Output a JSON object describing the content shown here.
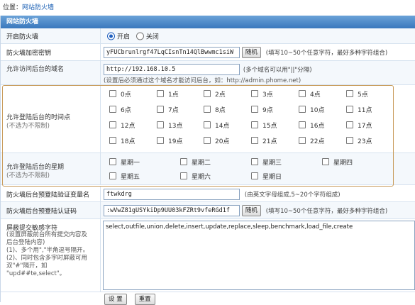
{
  "breadcrumb": {
    "prefix": "位置：",
    "link": "网站防火墙"
  },
  "section_title": "网站防火墙",
  "firewall": {
    "label": "开启防火墙",
    "on": "开启",
    "off": "关闭"
  },
  "key": {
    "label": "防火墙加密密钥",
    "value": "yFUCbrunlrgf47LqCIsnTn14QlBwwmc1siW",
    "button": "随机",
    "hint": "(填写10~50个任意字符，最好多种字符组合)"
  },
  "domain": {
    "label": "允许访问后台的域名",
    "value": "http://192.168.10.5",
    "hint1": "(多个域名可以用\"||\"分隔)",
    "hint2": "(设置后必须通过这个域名才能访问后台，如：http://admin.phome.net)"
  },
  "time": {
    "label": "允许登陆后台的时间点",
    "sublabel": "(不选为不限制)",
    "hours": [
      "0点",
      "1点",
      "2点",
      "3点",
      "4点",
      "5点",
      "6点",
      "7点",
      "8点",
      "9点",
      "10点",
      "11点",
      "12点",
      "13点",
      "14点",
      "15点",
      "16点",
      "17点",
      "18点",
      "19点",
      "20点",
      "21点",
      "22点",
      "23点"
    ]
  },
  "week": {
    "label": "允许登陆后台的星期",
    "sublabel": "(不选为不限制)",
    "days": [
      "星期一",
      "星期二",
      "星期三",
      "星期四",
      "星期五",
      "星期六",
      "星期日"
    ]
  },
  "verify_var": {
    "label": "防火墙后台预登陆验证变量名",
    "value": "ftwkdrg",
    "hint": "(由英文字母组成,5~20个字符组成)"
  },
  "auth_code": {
    "label": "防火墙后台预登陆认证码",
    "value": ":wVwZ81gUSYkiDp9UU03kFZRt9vfeRGd1f",
    "button": "随机",
    "hint": "(填写10~50个任意字符，最好多种字符组合)"
  },
  "sensitive": {
    "label": "屏蔽提交敏感字符",
    "desc": [
      "(设置屏蔽前台所有提交内容及",
      "后台登陆内容)",
      "(1)、多个用\",\"半角逗号隔开。",
      "(2)、同时包含多字时屏蔽可用",
      "双\"#\"隔开，如",
      "\"upd##te,select\"。"
    ],
    "value": "select,outfile,union,delete,insert,update,replace,sleep,benchmark,load_file,create"
  },
  "buttons": {
    "submit": "设 置",
    "reset": "重置"
  }
}
